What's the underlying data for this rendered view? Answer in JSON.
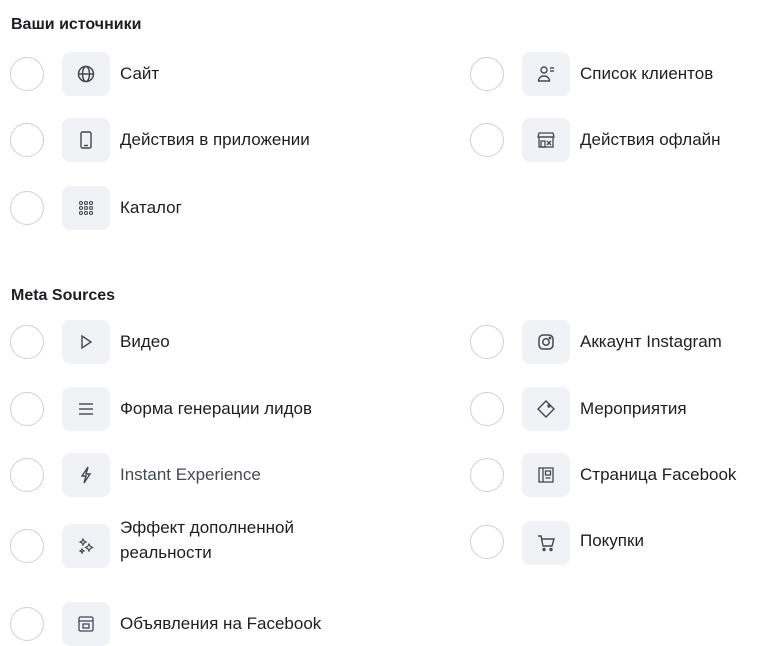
{
  "your_sources": {
    "title": "Ваши источники",
    "items": [
      {
        "label": "Сайт",
        "icon": "globe-icon"
      },
      {
        "label": "Список клиентов",
        "icon": "customer-list-icon"
      },
      {
        "label": "Действия в приложении",
        "icon": "mobile-phone-icon"
      },
      {
        "label": "Действия офлайн",
        "icon": "store-icon"
      },
      {
        "label": "Каталог",
        "icon": "catalog-grid-icon"
      }
    ]
  },
  "meta_sources": {
    "title": "Meta Sources",
    "items": [
      {
        "label": "Видео",
        "icon": "play-icon"
      },
      {
        "label": "Аккаунт Instagram",
        "icon": "instagram-icon"
      },
      {
        "label": "Форма генерации лидов",
        "icon": "list-lines-icon"
      },
      {
        "label": "Мероприятия",
        "icon": "tag-icon"
      },
      {
        "label": "Instant Experience",
        "icon": "lightning-icon"
      },
      {
        "label": "Страница Facebook",
        "icon": "facebook-page-icon"
      },
      {
        "label": "Эффект дополненной реальности",
        "icon": "sparkles-icon"
      },
      {
        "label": "Покупки",
        "icon": "shopping-cart-icon"
      },
      {
        "label": "Объявления на Facebook",
        "icon": "facebook-ads-icon"
      }
    ]
  }
}
